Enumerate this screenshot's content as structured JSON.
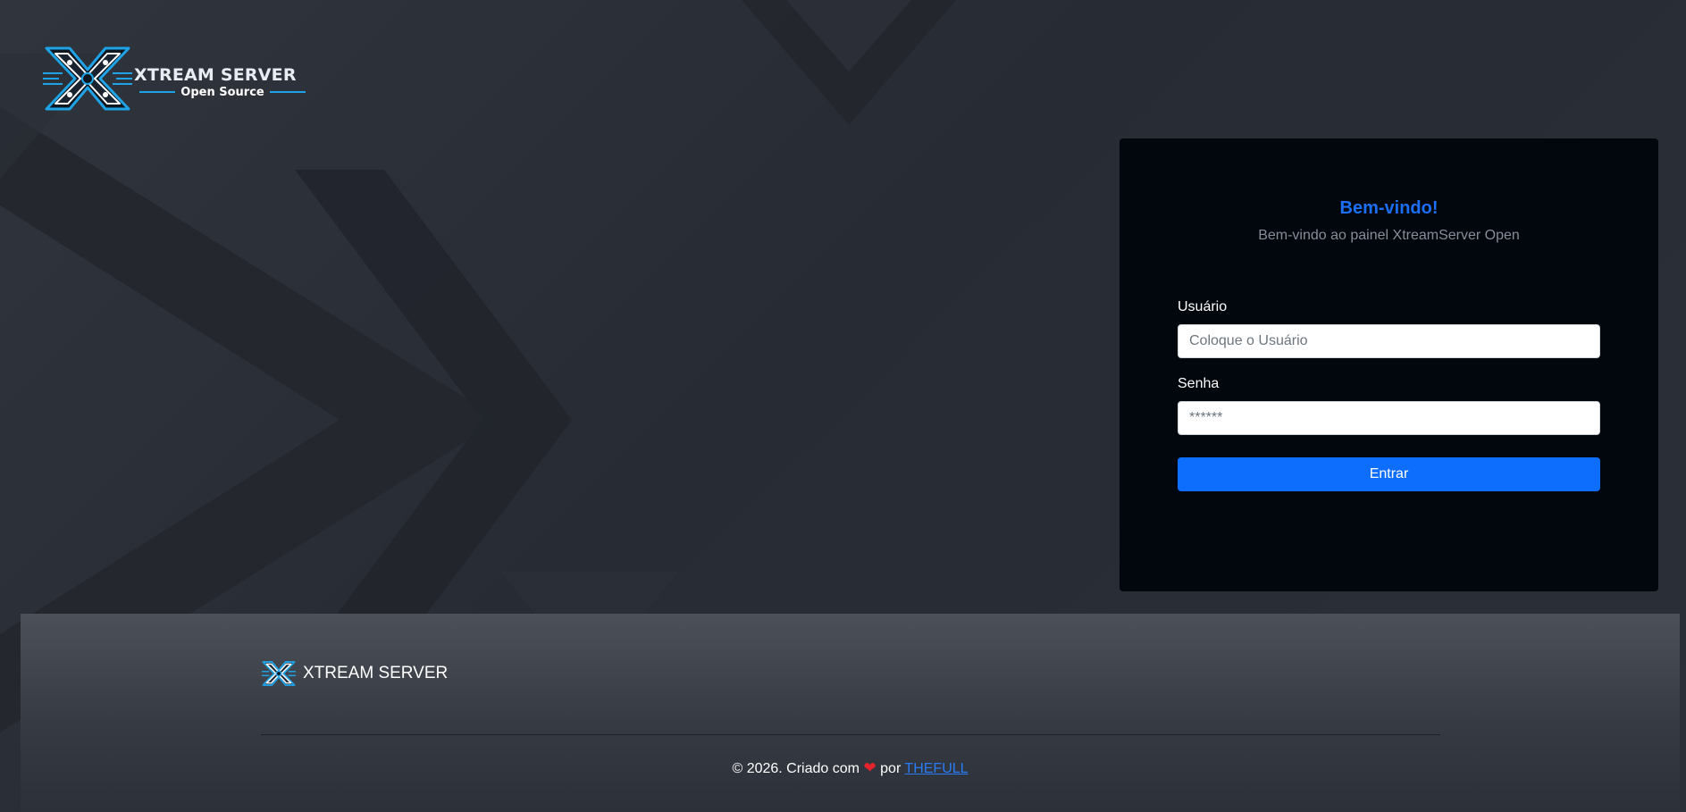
{
  "header": {
    "logo_title": "XTREAM SERVER",
    "logo_subtitle": "Open Source"
  },
  "login": {
    "title": "Bem-vindo!",
    "subtitle": "Bem-vindo ao painel XtreamServer Open",
    "username_label": "Usuário",
    "username_placeholder": "Coloque o Usuário",
    "username_value": "",
    "password_label": "Senha",
    "password_placeholder": "******",
    "password_value": "",
    "submit_label": "Entrar"
  },
  "footer": {
    "brand_name": "XTREAM SERVER",
    "copyright_prefix": "© 2026. Criado com",
    "heart": "❤",
    "by_text": "por",
    "author_link": "THEFULL"
  },
  "colors": {
    "accent_blue": "#0d6efd",
    "title_blue": "#1b6ff5",
    "card_bg": "#02060d",
    "logo_cyan": "#1fa3e6",
    "heart_red": "#e3242b"
  }
}
